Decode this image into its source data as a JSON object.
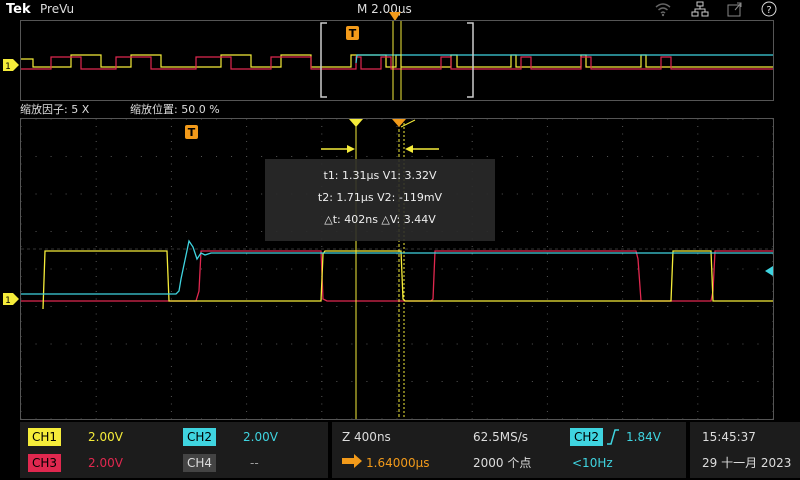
{
  "topbar": {
    "brand": "Tek",
    "mode": "PreVu",
    "timebase": "M 2.00µs"
  },
  "zoom_info": {
    "factor": "缩放因子: 5 X",
    "position": "缩放位置: 50.0 %"
  },
  "overview": {
    "ch1_marker": "1",
    "trigger_marker": "T"
  },
  "main": {
    "trigger_marker": "T",
    "ch1_marker": "1",
    "readout": {
      "t1": "t1: 1.31µs  V1: 3.32V",
      "t2": "t2: 1.71µs  V2: -119mV",
      "delta": "△t: 402ns  △V: 3.44V"
    }
  },
  "bottom": {
    "ch1": {
      "label": "CH1",
      "value": "2.00V"
    },
    "ch2": {
      "label": "CH2",
      "value": "2.00V"
    },
    "ch3": {
      "label": "CH3",
      "value": "2.00V"
    },
    "ch4": {
      "label": "CH4",
      "value": "--"
    },
    "zoom": "Z 400ns",
    "sample_rate": "62.5MS/s",
    "trigger_position": "1.64000µs",
    "record_length": "2000 个点",
    "trigger_channel": "CH2",
    "trigger_level": "1.84V",
    "trigger_freq": "<10Hz",
    "time": "15:45:37",
    "date": "29 十一月 2023"
  },
  "colors": {
    "ch1": "#f5ec3a",
    "ch2": "#3fd4e0",
    "ch3": "#e0284f",
    "ch4": "#9e9e9e",
    "trigger": "#f29a1a"
  }
}
